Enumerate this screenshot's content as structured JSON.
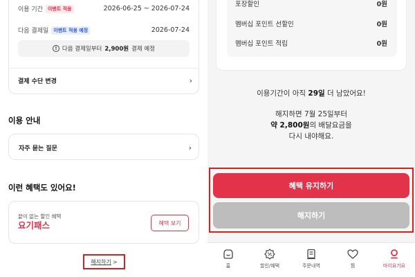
{
  "left": {
    "payment": {
      "period_label": "이용 기간",
      "period_badge": "이벤트 적용",
      "period_value": "2026-06-25 ~ 2026-07-24",
      "next_label": "다음 결제일",
      "next_badge": "이벤트 적용 예정",
      "next_value": "2026-07-24",
      "notice_pre": "다음 결제일부터",
      "notice_amount": "2,900원",
      "notice_post": "결제 예정",
      "change_method": "결제 수단 변경"
    },
    "guide": {
      "title": "이용 안내",
      "faq": "자주 묻는 질문"
    },
    "benefits": {
      "title": "이런 혜택도 있어요!",
      "subtitle": "끝이 없는 할인 혜택",
      "logo_text": "요기패스",
      "button": "혜택 보기"
    },
    "cancel_link": "해지하기",
    "cancel_chevron": ">"
  },
  "right": {
    "discounts": [
      {
        "label": "포장할인",
        "value": "0원"
      },
      {
        "label": "멤버십 포인트 선할인",
        "value": "0원"
      },
      {
        "label": "멤버십 포인트 적립",
        "value": "0원"
      }
    ],
    "remaining": {
      "pre": "이용기간이 아직",
      "days": "29일",
      "post": "더 남았어요!"
    },
    "warning": {
      "line1": "해지하면 7월 25일부터",
      "amount": "약 2,800원",
      "line2_post": "의 배달요금을",
      "line3": "다시 내야해요."
    },
    "keep_button": "혜택 유지하기",
    "cancel_button": "해지하기",
    "tabs": [
      {
        "label": "홈",
        "icon": "home-icon",
        "active": false
      },
      {
        "label": "할인/혜택",
        "icon": "discount-icon",
        "active": false
      },
      {
        "label": "주문내역",
        "icon": "receipt-icon",
        "active": false
      },
      {
        "label": "찜",
        "icon": "heart-icon",
        "active": false
      },
      {
        "label": "마이요기요",
        "icon": "my-profile-icon",
        "active": true
      }
    ]
  },
  "colors": {
    "accent": "#e2334a",
    "highlight_border": "#d81e1e",
    "disabled_button": "#bdbdbd"
  }
}
